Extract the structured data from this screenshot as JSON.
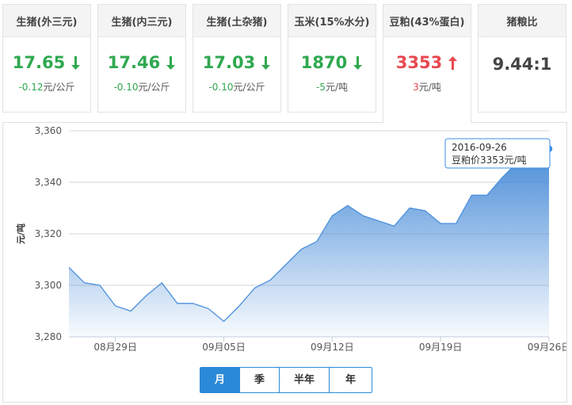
{
  "cards": [
    {
      "title": "生猪(外三元)",
      "value": "17.65",
      "trend": "down",
      "change": "-0.12",
      "unit": "元/公斤"
    },
    {
      "title": "生猪(内三元)",
      "value": "17.46",
      "trend": "down",
      "change": "-0.10",
      "unit": "元/公斤"
    },
    {
      "title": "生猪(土杂猪)",
      "value": "17.03",
      "trend": "down",
      "change": "-0.10",
      "unit": "元/公斤"
    },
    {
      "title": "玉米(15%水分)",
      "value": "1870",
      "trend": "down",
      "change": "-5",
      "unit": "元/吨"
    },
    {
      "title": "豆粕(43%蛋白)",
      "value": "3353",
      "trend": "up",
      "change": "3",
      "unit": "元/吨"
    },
    {
      "title": "猪粮比",
      "value": "9.44:1"
    }
  ],
  "colors": {
    "down": "#2fa84f",
    "up": "#e8474f",
    "line": "#4a8fdc",
    "accent": "#2b8ad8"
  },
  "chart_data": {
    "type": "area",
    "ylabel": "元/吨",
    "ylim": [
      3280,
      3360
    ],
    "yticks": [
      "3,280",
      "3,300",
      "3,320",
      "3,340",
      "3,360"
    ],
    "xticks": [
      {
        "date": "2016-08-29",
        "label": "08月29日"
      },
      {
        "date": "2016-09-05",
        "label": "09月05日"
      },
      {
        "date": "2016-09-12",
        "label": "09月12日"
      },
      {
        "date": "2016-09-19",
        "label": "09月19日"
      },
      {
        "date": "2016-09-26",
        "label": "09月26日"
      }
    ],
    "x": [
      "2016-08-26",
      "2016-08-27",
      "2016-08-28",
      "2016-08-29",
      "2016-08-30",
      "2016-08-31",
      "2016-09-01",
      "2016-09-02",
      "2016-09-03",
      "2016-09-04",
      "2016-09-05",
      "2016-09-06",
      "2016-09-07",
      "2016-09-08",
      "2016-09-09",
      "2016-09-10",
      "2016-09-11",
      "2016-09-12",
      "2016-09-13",
      "2016-09-14",
      "2016-09-15",
      "2016-09-16",
      "2016-09-17",
      "2016-09-18",
      "2016-09-19",
      "2016-09-20",
      "2016-09-21",
      "2016-09-22",
      "2016-09-23",
      "2016-09-24",
      "2016-09-25",
      "2016-09-26"
    ],
    "values": [
      3307,
      3301,
      3300,
      3292,
      3290,
      3296,
      3301,
      3293,
      3293,
      3291,
      3286,
      3292,
      3299,
      3302,
      3308,
      3314,
      3317,
      3327,
      3331,
      3327,
      3325,
      3323,
      3330,
      3329,
      3324,
      3324,
      3335,
      3335,
      3342,
      3348,
      3350,
      3353
    ],
    "tooltip": {
      "date": "2016-09-26",
      "label": "豆粕价3353元/吨"
    }
  },
  "range_tabs": [
    {
      "label": "月",
      "active": true
    },
    {
      "label": "季",
      "active": false
    },
    {
      "label": "半年",
      "active": false
    },
    {
      "label": "年",
      "active": false
    }
  ]
}
